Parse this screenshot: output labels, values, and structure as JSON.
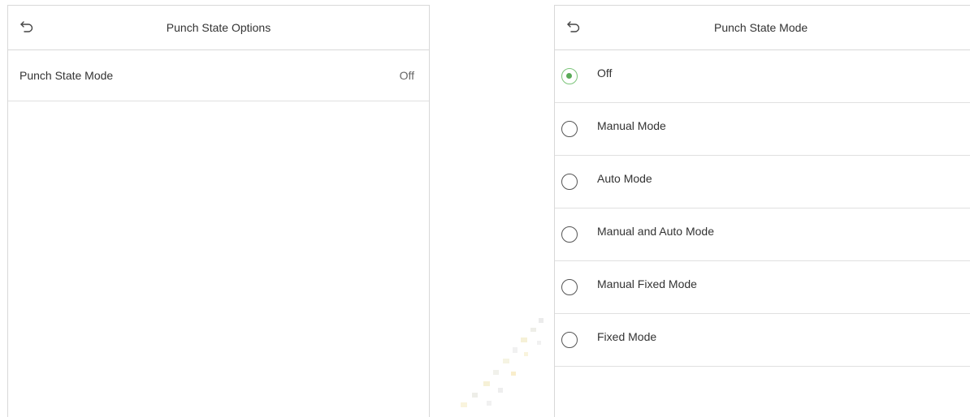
{
  "left_screen": {
    "title": "Punch State Options",
    "rows": [
      {
        "label": "Punch State Mode",
        "value": "Off"
      }
    ]
  },
  "right_screen": {
    "title": "Punch State Mode",
    "selected_index": 0,
    "options": [
      {
        "label": "Off"
      },
      {
        "label": "Manual Mode"
      },
      {
        "label": "Auto Mode"
      },
      {
        "label": "Manual and Auto Mode"
      },
      {
        "label": "Manual Fixed Mode"
      },
      {
        "label": "Fixed Mode"
      }
    ]
  },
  "colors": {
    "radio_selected": "#5aaa58",
    "divider": "#e0e0e0"
  }
}
